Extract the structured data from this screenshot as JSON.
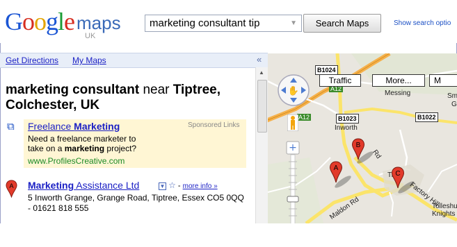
{
  "header": {
    "logo_letters": [
      "G",
      "o",
      "o",
      "g",
      "l",
      "e"
    ],
    "logo_maps": "maps",
    "logo_region": "UK",
    "search_value": "marketing consultant tip",
    "search_button": "Search Maps",
    "show_options": "Show search optio"
  },
  "nav": {
    "get_directions": "Get Directions",
    "my_maps": "My Maps",
    "collapse": "«"
  },
  "results": {
    "query": "marketing consultant",
    "near": "near",
    "location": "Tiptree, Colchester, UK",
    "ad": {
      "title_plain": "Freelance ",
      "title_bold": "Marketing",
      "sponsored_label": "Sponsored Links",
      "desc_1": "Need a freelance marketer to",
      "desc_2a": "take on a ",
      "desc_2b": "marketing",
      "desc_2c": " project?",
      "url": "www.ProfilesCreative.com"
    },
    "result_a": {
      "pin": "A",
      "title_bold": "Marketing",
      "title_rest": " Assistance Ltd",
      "more_info": "more info »",
      "address": "5 Inworth Grange, Grange Road, Tiptree, Essex CO5 0QQ - 01621 818 555"
    }
  },
  "map": {
    "buttons": {
      "traffic": "Traffic",
      "more": "More...",
      "m": "M"
    },
    "roads": {
      "b1024": "B1024",
      "b1023": "B1023",
      "b1022": "B1022",
      "a12_top": "A12",
      "a12_left": "A12"
    },
    "places": {
      "messing": "Messing",
      "inworth": "Inworth",
      "tipt": "Tipt",
      "tolleshu": "Tolleshu",
      "knights": "Knights",
      "sm": "Sm",
      "g": "G"
    },
    "street_labels": {
      "maldon": "Maldon Rd",
      "factory": "Factory Hill",
      "rd": "Rd"
    },
    "pins": [
      "A",
      "B",
      "C"
    ],
    "colors": {
      "pin_red": "#e23a2a",
      "road_orange": "#f5b04a",
      "road_yellow": "#fbe46a",
      "land": "#e9e6df"
    }
  }
}
